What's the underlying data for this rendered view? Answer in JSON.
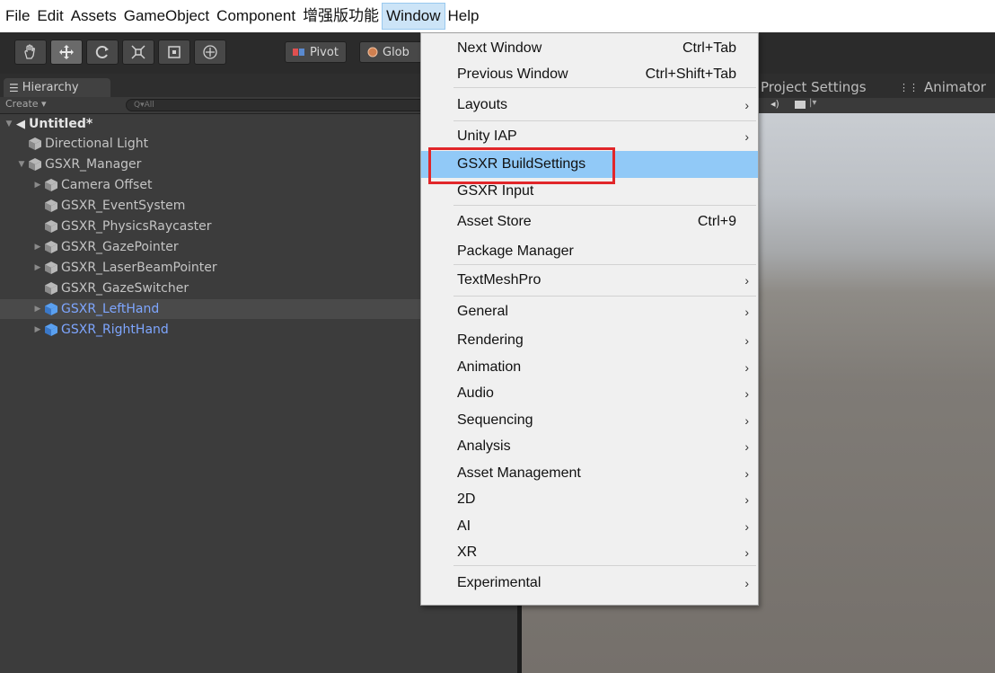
{
  "menubar": {
    "items": [
      {
        "label": "File",
        "active": false
      },
      {
        "label": "Edit",
        "active": false
      },
      {
        "label": "Assets",
        "active": false
      },
      {
        "label": "GameObject",
        "active": false
      },
      {
        "label": "Component",
        "active": false
      },
      {
        "label": "增强版功能",
        "active": false
      },
      {
        "label": "Window",
        "active": true
      },
      {
        "label": "Help",
        "active": false
      }
    ]
  },
  "toolbar": {
    "tools": [
      "hand-icon",
      "move-icon",
      "rotate-icon",
      "scale-icon",
      "rect-icon",
      "transform-icon"
    ],
    "pivot_label": "Pivot",
    "global_label": "Glob"
  },
  "hierarchy": {
    "tab_label": "Hierarchy",
    "create_label": "Create ▾",
    "search_placeholder": "Q▾All",
    "scene_name": "Untitled*",
    "rows": [
      {
        "label": "Directional Light",
        "indent": 1,
        "arrow": "",
        "cube": "gray",
        "blue": false,
        "selected": false
      },
      {
        "label": "GSXR_Manager",
        "indent": 1,
        "arrow": "▼",
        "cube": "gray",
        "blue": false,
        "selected": false
      },
      {
        "label": "Camera Offset",
        "indent": 2,
        "arrow": "▶",
        "cube": "gray",
        "blue": false,
        "selected": false
      },
      {
        "label": "GSXR_EventSystem",
        "indent": 2,
        "arrow": "",
        "cube": "gray",
        "blue": false,
        "selected": false
      },
      {
        "label": "GSXR_PhysicsRaycaster",
        "indent": 2,
        "arrow": "",
        "cube": "gray",
        "blue": false,
        "selected": false
      },
      {
        "label": "GSXR_GazePointer",
        "indent": 2,
        "arrow": "▶",
        "cube": "gray",
        "blue": false,
        "selected": false
      },
      {
        "label": "GSXR_LaserBeamPointer",
        "indent": 2,
        "arrow": "▶",
        "cube": "gray",
        "blue": false,
        "selected": false
      },
      {
        "label": "GSXR_GazeSwitcher",
        "indent": 2,
        "arrow": "",
        "cube": "gray",
        "blue": false,
        "selected": false
      },
      {
        "label": "GSXR_LeftHand",
        "indent": 2,
        "arrow": "▶",
        "cube": "blue",
        "blue": true,
        "selected": true
      },
      {
        "label": "GSXR_RightHand",
        "indent": 2,
        "arrow": "▶",
        "cube": "blue",
        "blue": true,
        "selected": false
      }
    ]
  },
  "scene": {
    "tabs": [
      {
        "label": "Project Settings",
        "icon": ""
      },
      {
        "label": "Animator",
        "icon": "animator-icon"
      }
    ]
  },
  "window_menu": {
    "items": [
      {
        "label": "Next Window",
        "shortcut": "Ctrl+Tab",
        "submenu": false,
        "highlighted": false,
        "separator_after": false
      },
      {
        "label": "Previous Window",
        "shortcut": "Ctrl+Shift+Tab",
        "submenu": false,
        "highlighted": false,
        "separator_after": true
      },
      {
        "label": "Layouts",
        "shortcut": "",
        "submenu": true,
        "highlighted": false,
        "separator_after": true
      },
      {
        "label": "Unity IAP",
        "shortcut": "",
        "submenu": true,
        "highlighted": false,
        "separator_after": false
      },
      {
        "label": "GSXR BuildSettings",
        "shortcut": "",
        "submenu": false,
        "highlighted": true,
        "separator_after": false
      },
      {
        "label": "GSXR Input",
        "shortcut": "",
        "submenu": false,
        "highlighted": false,
        "separator_after": true
      },
      {
        "label": "Asset Store",
        "shortcut": "Ctrl+9",
        "submenu": false,
        "highlighted": false,
        "separator_after": false
      },
      {
        "label": "Package Manager",
        "shortcut": "",
        "submenu": false,
        "highlighted": false,
        "separator_after": true
      },
      {
        "label": "TextMeshPro",
        "shortcut": "",
        "submenu": true,
        "highlighted": false,
        "separator_after": true
      },
      {
        "label": "General",
        "shortcut": "",
        "submenu": true,
        "highlighted": false,
        "separator_after": false
      },
      {
        "label": "Rendering",
        "shortcut": "",
        "submenu": true,
        "highlighted": false,
        "separator_after": false
      },
      {
        "label": "Animation",
        "shortcut": "",
        "submenu": true,
        "highlighted": false,
        "separator_after": false
      },
      {
        "label": "Audio",
        "shortcut": "",
        "submenu": true,
        "highlighted": false,
        "separator_after": false
      },
      {
        "label": "Sequencing",
        "shortcut": "",
        "submenu": true,
        "highlighted": false,
        "separator_after": false
      },
      {
        "label": "Analysis",
        "shortcut": "",
        "submenu": true,
        "highlighted": false,
        "separator_after": false
      },
      {
        "label": "Asset Management",
        "shortcut": "",
        "submenu": true,
        "highlighted": false,
        "separator_after": false
      },
      {
        "label": "2D",
        "shortcut": "",
        "submenu": true,
        "highlighted": false,
        "separator_after": false
      },
      {
        "label": "AI",
        "shortcut": "",
        "submenu": true,
        "highlighted": false,
        "separator_after": false
      },
      {
        "label": "XR",
        "shortcut": "",
        "submenu": true,
        "highlighted": false,
        "separator_after": true
      },
      {
        "label": "Experimental",
        "shortcut": "",
        "submenu": true,
        "highlighted": false,
        "separator_after": false
      }
    ]
  },
  "colors": {
    "menu_highlight": "#91c9f7",
    "annotation_box": "#e1262a",
    "editor_dark": "#3c3c3c",
    "prefab_blue": "#7ea6ff"
  }
}
